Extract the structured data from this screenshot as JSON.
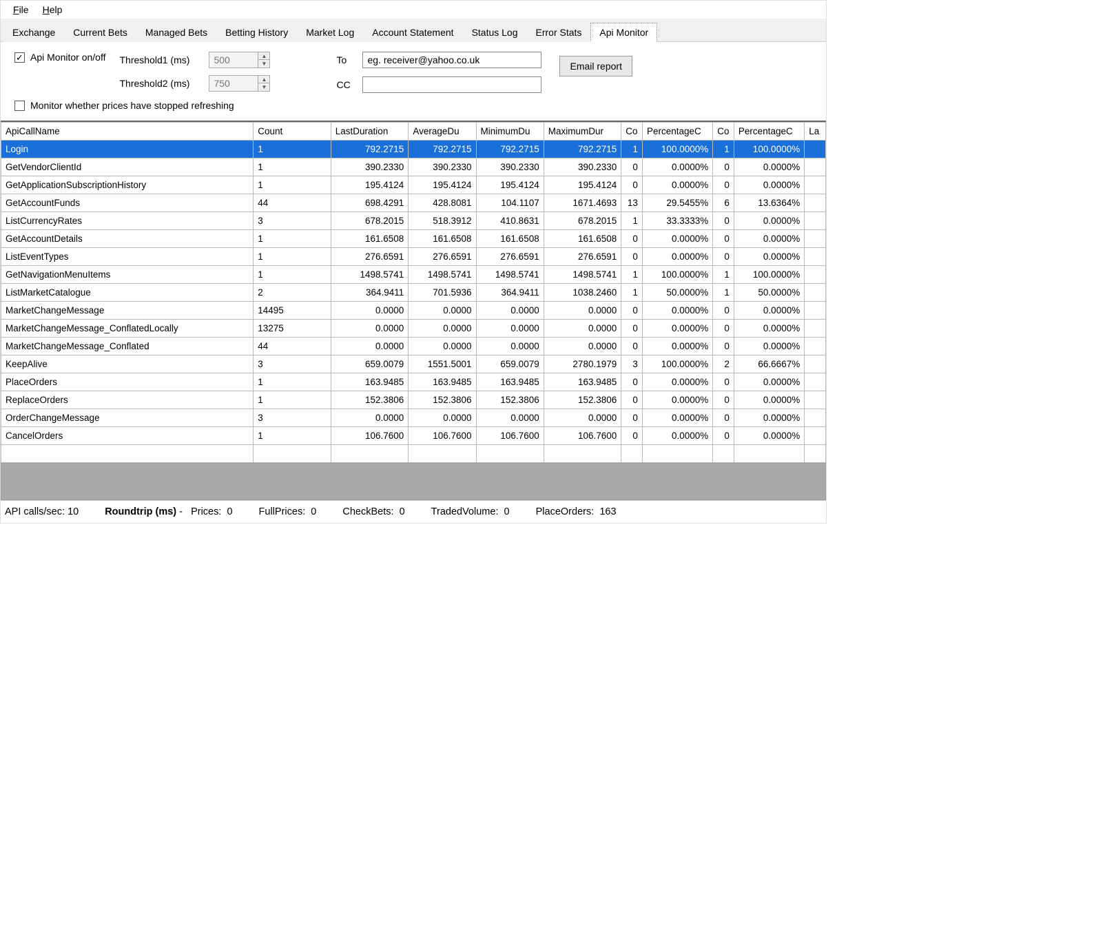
{
  "menu": {
    "file": "File",
    "help": "Help"
  },
  "tabs": [
    {
      "id": "exchange",
      "label": "Exchange"
    },
    {
      "id": "current-bets",
      "label": "Current Bets"
    },
    {
      "id": "managed-bets",
      "label": "Managed Bets"
    },
    {
      "id": "betting-history",
      "label": "Betting History"
    },
    {
      "id": "market-log",
      "label": "Market Log"
    },
    {
      "id": "account-statement",
      "label": "Account Statement"
    },
    {
      "id": "status-log",
      "label": "Status Log"
    },
    {
      "id": "error-stats",
      "label": "Error Stats"
    },
    {
      "id": "api-monitor",
      "label": "Api Monitor",
      "active": true
    }
  ],
  "panel": {
    "apiMonitorLabel": "Api Monitor on/off",
    "threshold1Label": "Threshold1 (ms)",
    "threshold2Label": "Threshold2 (ms)",
    "threshold1Value": "500",
    "threshold2Value": "750",
    "monitorRefreshLabel": "Monitor whether prices have stopped refreshing",
    "toLabel": "To",
    "ccLabel": "CC",
    "toPlaceholder": "eg. receiver@yahoo.co.uk",
    "emailReportBtn": "Email report"
  },
  "grid": {
    "headers": [
      "ApiCallName",
      "Count",
      "LastDuration",
      "AverageDu",
      "MinimumDu",
      "MaximumDur",
      "Co",
      "PercentageC",
      "Co",
      "PercentageC",
      "La"
    ],
    "rows": [
      {
        "name": "Login",
        "count": "1",
        "last": "792.2715",
        "avg": "792.2715",
        "min": "792.2715",
        "max": "792.2715",
        "c1": "1",
        "p1": "100.0000%",
        "c2": "1",
        "p2": "100.0000%",
        "selected": true
      },
      {
        "name": "GetVendorClientId",
        "count": "1",
        "last": "390.2330",
        "avg": "390.2330",
        "min": "390.2330",
        "max": "390.2330",
        "c1": "0",
        "p1": "0.0000%",
        "c2": "0",
        "p2": "0.0000%"
      },
      {
        "name": "GetApplicationSubscriptionHistory",
        "count": "1",
        "last": "195.4124",
        "avg": "195.4124",
        "min": "195.4124",
        "max": "195.4124",
        "c1": "0",
        "p1": "0.0000%",
        "c2": "0",
        "p2": "0.0000%"
      },
      {
        "name": "GetAccountFunds",
        "count": "44",
        "last": "698.4291",
        "avg": "428.8081",
        "min": "104.1107",
        "max": "1671.4693",
        "c1": "13",
        "p1": "29.5455%",
        "c2": "6",
        "p2": "13.6364%"
      },
      {
        "name": "ListCurrencyRates",
        "count": "3",
        "last": "678.2015",
        "avg": "518.3912",
        "min": "410.8631",
        "max": "678.2015",
        "c1": "1",
        "p1": "33.3333%",
        "c2": "0",
        "p2": "0.0000%"
      },
      {
        "name": "GetAccountDetails",
        "count": "1",
        "last": "161.6508",
        "avg": "161.6508",
        "min": "161.6508",
        "max": "161.6508",
        "c1": "0",
        "p1": "0.0000%",
        "c2": "0",
        "p2": "0.0000%"
      },
      {
        "name": "ListEventTypes",
        "count": "1",
        "last": "276.6591",
        "avg": "276.6591",
        "min": "276.6591",
        "max": "276.6591",
        "c1": "0",
        "p1": "0.0000%",
        "c2": "0",
        "p2": "0.0000%"
      },
      {
        "name": "GetNavigationMenuItems",
        "count": "1",
        "last": "1498.5741",
        "avg": "1498.5741",
        "min": "1498.5741",
        "max": "1498.5741",
        "c1": "1",
        "p1": "100.0000%",
        "c2": "1",
        "p2": "100.0000%"
      },
      {
        "name": "ListMarketCatalogue",
        "count": "2",
        "last": "364.9411",
        "avg": "701.5936",
        "min": "364.9411",
        "max": "1038.2460",
        "c1": "1",
        "p1": "50.0000%",
        "c2": "1",
        "p2": "50.0000%"
      },
      {
        "name": "MarketChangeMessage",
        "count": "14495",
        "last": "0.0000",
        "avg": "0.0000",
        "min": "0.0000",
        "max": "0.0000",
        "c1": "0",
        "p1": "0.0000%",
        "c2": "0",
        "p2": "0.0000%"
      },
      {
        "name": "MarketChangeMessage_ConflatedLocally",
        "count": "13275",
        "last": "0.0000",
        "avg": "0.0000",
        "min": "0.0000",
        "max": "0.0000",
        "c1": "0",
        "p1": "0.0000%",
        "c2": "0",
        "p2": "0.0000%"
      },
      {
        "name": "MarketChangeMessage_Conflated",
        "count": "44",
        "last": "0.0000",
        "avg": "0.0000",
        "min": "0.0000",
        "max": "0.0000",
        "c1": "0",
        "p1": "0.0000%",
        "c2": "0",
        "p2": "0.0000%"
      },
      {
        "name": "KeepAlive",
        "count": "3",
        "last": "659.0079",
        "avg": "1551.5001",
        "min": "659.0079",
        "max": "2780.1979",
        "c1": "3",
        "p1": "100.0000%",
        "c2": "2",
        "p2": "66.6667%"
      },
      {
        "name": "PlaceOrders",
        "count": "1",
        "last": "163.9485",
        "avg": "163.9485",
        "min": "163.9485",
        "max": "163.9485",
        "c1": "0",
        "p1": "0.0000%",
        "c2": "0",
        "p2": "0.0000%"
      },
      {
        "name": "ReplaceOrders",
        "count": "1",
        "last": "152.3806",
        "avg": "152.3806",
        "min": "152.3806",
        "max": "152.3806",
        "c1": "0",
        "p1": "0.0000%",
        "c2": "0",
        "p2": "0.0000%"
      },
      {
        "name": "OrderChangeMessage",
        "count": "3",
        "last": "0.0000",
        "avg": "0.0000",
        "min": "0.0000",
        "max": "0.0000",
        "c1": "0",
        "p1": "0.0000%",
        "c2": "0",
        "p2": "0.0000%"
      },
      {
        "name": "CancelOrders",
        "count": "1",
        "last": "106.7600",
        "avg": "106.7600",
        "min": "106.7600",
        "max": "106.7600",
        "c1": "0",
        "p1": "0.0000%",
        "c2": "0",
        "p2": "0.0000%"
      }
    ]
  },
  "status": {
    "apiCallsLabel": "API calls/sec:",
    "apiCallsVal": "10",
    "roundtripLabel": "Roundtrip (ms)",
    "dash": "-",
    "pricesLabel": "Prices:",
    "pricesVal": "0",
    "fullPricesLabel": "FullPrices:",
    "fullPricesVal": "0",
    "checkBetsLabel": "CheckBets:",
    "checkBetsVal": "0",
    "tradedVolLabel": "TradedVolume:",
    "tradedVolVal": "0",
    "placeOrdersLabel": "PlaceOrders:",
    "placeOrdersVal": "163"
  }
}
